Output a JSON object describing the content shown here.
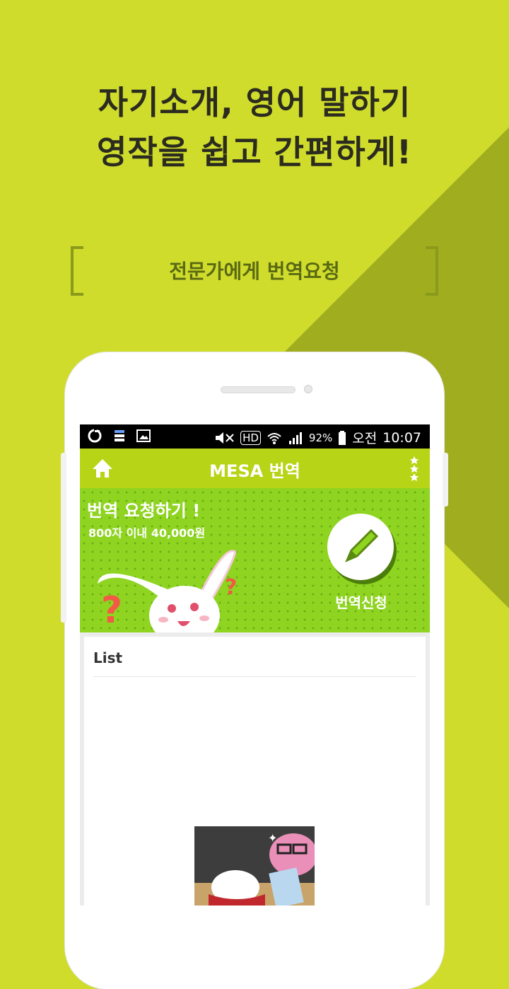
{
  "headline": {
    "line1": "자기소개, 영어 말하기",
    "line2": "영작을 쉽고 간편하게!"
  },
  "subtitle": "전문가에게 번역요청",
  "status_bar": {
    "hd": "HD",
    "battery": "92%",
    "ampm": "오전",
    "time": "10:07"
  },
  "app_bar": {
    "title": "MESA 번역",
    "home_icon": "home-icon",
    "menu_icon": "star-menu-icon"
  },
  "banner": {
    "title": "번역 요청하기 !",
    "subtitle": "800자 이내 40,000원",
    "button_label": "번역신청",
    "button_icon": "pencil-icon"
  },
  "list": {
    "title": "List"
  },
  "colors": {
    "background": "#cfdc2c",
    "app_bar": "#b8d417",
    "banner": "#8fd421"
  }
}
